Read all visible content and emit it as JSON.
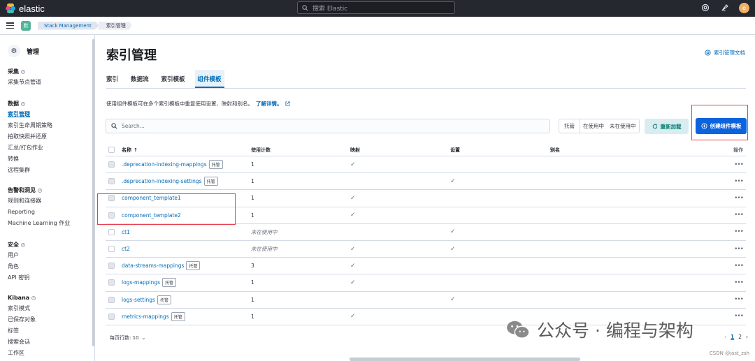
{
  "topbar": {
    "logo_text": "elastic",
    "search_placeholder": "搜索 Elastic",
    "avatar_initial": "e"
  },
  "subbar": {
    "space_initial": "默",
    "breadcrumbs": [
      "Stack Management",
      "索引管理"
    ]
  },
  "sidenav": {
    "title": "管理",
    "groups": [
      {
        "title": "采集",
        "items": [
          "采集节点管道"
        ]
      },
      {
        "title": "数据",
        "items": [
          "索引管理",
          "索引生命周期策略",
          "拍取快照并还原",
          "汇总/打包作业",
          "转换",
          "远程集群"
        ]
      },
      {
        "title": "告警和洞见",
        "items": [
          "规则和连接器",
          "Reporting",
          "Machine Learning 作业"
        ]
      },
      {
        "title": "安全",
        "items": [
          "用户",
          "角色",
          "API 密钥"
        ]
      },
      {
        "title": "Kibana",
        "items": [
          "索引模式",
          "已保存对象",
          "标签",
          "搜索会话",
          "工作区"
        ]
      }
    ],
    "active_item": "索引管理"
  },
  "main": {
    "title": "索引管理",
    "doc_link": "索引管理文档",
    "tabs": [
      "索引",
      "数据流",
      "索引模板",
      "组件模板"
    ],
    "selected_tab": "组件模板",
    "description": "使用组件模板可在多个索引模板中重复使用设置、映射和别名。",
    "learn_more": "了解详情。",
    "search_placeholder": "Search...",
    "filters": [
      "托管",
      "在使用中",
      "未在使用中"
    ],
    "reload_label": "重新加载",
    "create_label": "创建组件模板"
  },
  "table": {
    "headers": {
      "name": "名称",
      "usage": "使用计数",
      "mappings": "映射",
      "settings": "设置",
      "aliases": "别名",
      "actions": "操作"
    },
    "rows": [
      {
        "name": ".deprecation-indexing-mappings",
        "managed": true,
        "usage": "1",
        "unused": false,
        "mappings": true,
        "settings": false,
        "checkbox_filled": true
      },
      {
        "name": ".deprecation-indexing-settings",
        "managed": true,
        "usage": "1",
        "unused": false,
        "mappings": false,
        "settings": true,
        "checkbox_filled": true
      },
      {
        "name": "component_template1",
        "managed": false,
        "usage": "1",
        "unused": false,
        "mappings": true,
        "settings": false,
        "checkbox_filled": true
      },
      {
        "name": "component_template2",
        "managed": false,
        "usage": "1",
        "unused": false,
        "mappings": true,
        "settings": false,
        "checkbox_filled": true
      },
      {
        "name": "ct1",
        "managed": false,
        "usage": "未在使用中",
        "unused": true,
        "mappings": false,
        "settings": true,
        "checkbox_filled": false
      },
      {
        "name": "ct2",
        "managed": false,
        "usage": "未在使用中",
        "unused": true,
        "mappings": true,
        "settings": true,
        "checkbox_filled": false
      },
      {
        "name": "data-streams-mappings",
        "managed": true,
        "usage": "3",
        "unused": false,
        "mappings": true,
        "settings": false,
        "checkbox_filled": true
      },
      {
        "name": "logs-mappings",
        "managed": true,
        "usage": "1",
        "unused": false,
        "mappings": true,
        "settings": false,
        "checkbox_filled": true
      },
      {
        "name": "logs-settings",
        "managed": true,
        "usage": "1",
        "unused": false,
        "mappings": false,
        "settings": true,
        "checkbox_filled": true
      },
      {
        "name": "metrics-mappings",
        "managed": true,
        "usage": "1",
        "unused": false,
        "mappings": true,
        "settings": false,
        "checkbox_filled": true
      }
    ],
    "managed_badge": "托管",
    "actions_glyph": "•••",
    "check_glyph": "✓"
  },
  "pagination": {
    "rows_per_page": "每页行数: 10",
    "pages": [
      "1",
      "2"
    ],
    "current_page": "1"
  },
  "watermark": {
    "text": "公众号 · 编程与架构",
    "csdn": "CSDN @jast_zsh"
  }
}
